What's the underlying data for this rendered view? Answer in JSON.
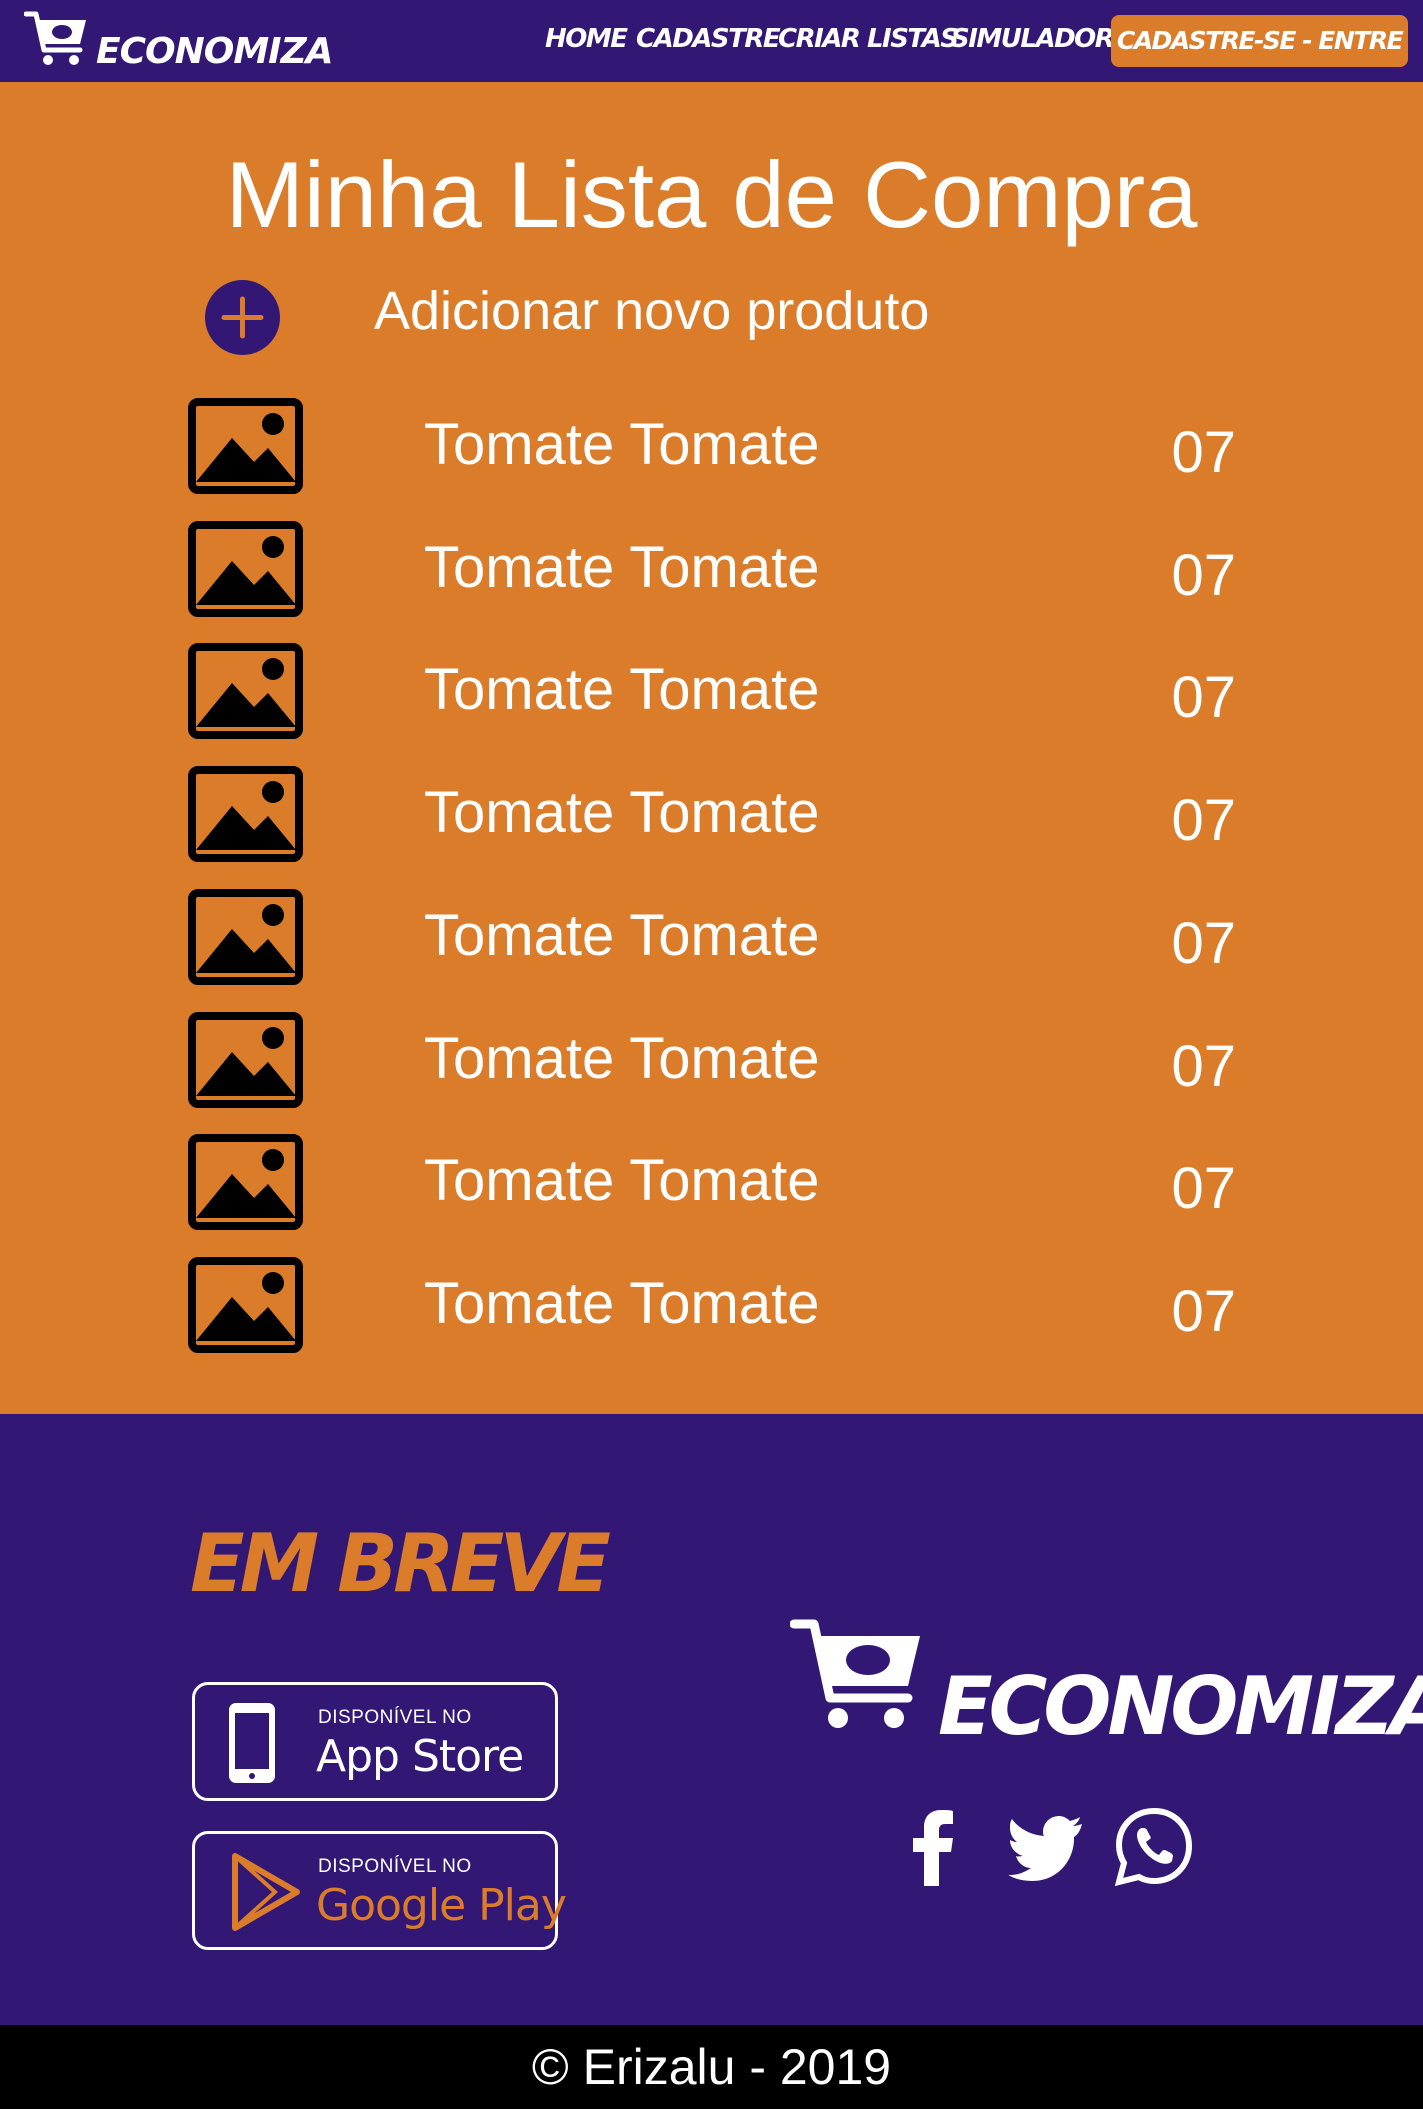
{
  "colors": {
    "brand_purple": "#321874",
    "brand_orange": "#DA7C2A",
    "footer_bar": "#000000",
    "text": "#FFFFFF"
  },
  "navbar": {
    "brand": "ECONOMIZA",
    "links": [
      "HOME",
      "CADASTRE",
      "CRIAR LISTAS",
      "SIMULADOR"
    ],
    "cta": "CADASTRE-SE - ENTRE"
  },
  "main": {
    "title": "Minha Lista de Compra",
    "add_label": "Adicionar novo produto",
    "items": [
      {
        "name": "Tomate Tomate",
        "qty": "07",
        "icon": "image-placeholder-icon"
      },
      {
        "name": "Tomate Tomate",
        "qty": "07",
        "icon": "image-placeholder-icon"
      },
      {
        "name": "Tomate Tomate",
        "qty": "07",
        "icon": "image-placeholder-icon"
      },
      {
        "name": "Tomate Tomate",
        "qty": "07",
        "icon": "image-placeholder-icon"
      },
      {
        "name": "Tomate Tomate",
        "qty": "07",
        "icon": "image-placeholder-icon"
      },
      {
        "name": "Tomate Tomate",
        "qty": "07",
        "icon": "image-placeholder-icon"
      },
      {
        "name": "Tomate Tomate",
        "qty": "07",
        "icon": "image-placeholder-icon"
      },
      {
        "name": "Tomate Tomate",
        "qty": "07",
        "icon": "image-placeholder-icon"
      }
    ]
  },
  "footer": {
    "soon": "EM BREVE",
    "app_store": {
      "small": "DISPONÍVEL NO",
      "big": "App Store"
    },
    "google_play": {
      "small": "DISPONÍVEL NO",
      "big": "Google Play"
    },
    "brand": "ECONOMIZA",
    "social": [
      "facebook-icon",
      "twitter-icon",
      "whatsapp-icon"
    ]
  },
  "copyright": "© Erizalu - 2019"
}
